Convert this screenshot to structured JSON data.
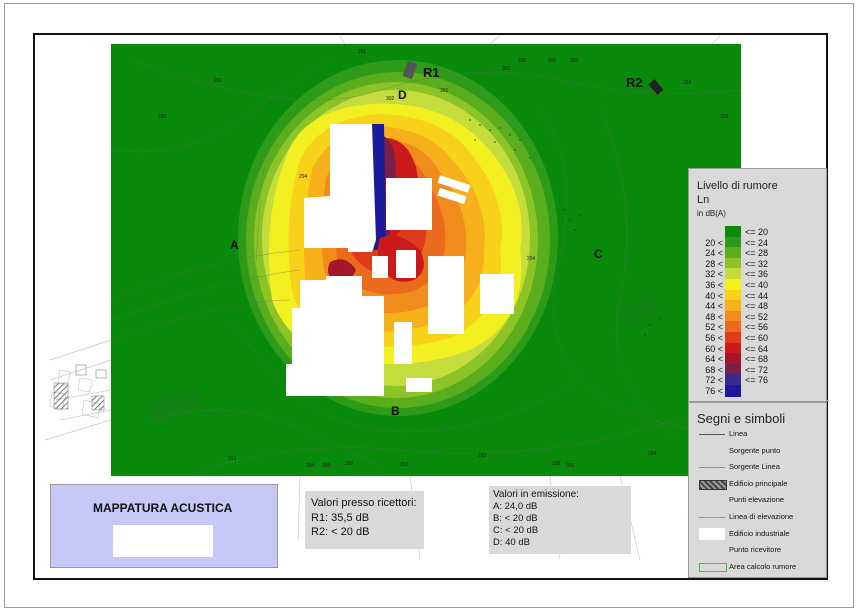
{
  "map": {
    "receptor_labels": [
      "R1",
      "R2"
    ],
    "point_labels": [
      "A",
      "B",
      "C",
      "D"
    ],
    "elevations": [
      "291",
      "290",
      "291",
      "293",
      "291",
      "292",
      "289",
      "298",
      "294",
      "294",
      "293",
      "294",
      "289",
      "290",
      "292",
      "293",
      "300",
      "306",
      "284",
      "302",
      "301",
      "307"
    ]
  },
  "legend": {
    "title": "Livello di rumore",
    "subtitle": "Ln",
    "unit": "in dB(A)",
    "classes": [
      {
        "lo": "",
        "hi": "<= 20",
        "color": "#0a8a0a"
      },
      {
        "lo": "20 <",
        "hi": "<= 24",
        "color": "#2e9a1a"
      },
      {
        "lo": "24 <",
        "hi": "<= 28",
        "color": "#5aae1e"
      },
      {
        "lo": "28 <",
        "hi": "<= 32",
        "color": "#8cc428"
      },
      {
        "lo": "32 <",
        "hi": "<= 36",
        "color": "#c4dc3c"
      },
      {
        "lo": "36 <",
        "hi": "<= 40",
        "color": "#f2f020"
      },
      {
        "lo": "40 <",
        "hi": "<= 44",
        "color": "#f8d21a"
      },
      {
        "lo": "44 <",
        "hi": "<= 48",
        "color": "#f6b01c"
      },
      {
        "lo": "48 <",
        "hi": "<= 52",
        "color": "#f08c1c"
      },
      {
        "lo": "52 <",
        "hi": "<= 56",
        "color": "#ea6a1e"
      },
      {
        "lo": "56 <",
        "hi": "<= 60",
        "color": "#e03a1c"
      },
      {
        "lo": "60 <",
        "hi": "<= 64",
        "color": "#cc1a1a"
      },
      {
        "lo": "64 <",
        "hi": "<= 68",
        "color": "#a41628"
      },
      {
        "lo": "68 <",
        "hi": "<= 72",
        "color": "#78204a"
      },
      {
        "lo": "72 <",
        "hi": "<= 76",
        "color": "#3a2a8a"
      },
      {
        "lo": "76 <",
        "hi": "",
        "color": "#1a1a9a"
      }
    ]
  },
  "symbols": {
    "title": "Segni e simboli",
    "items": [
      {
        "label": "Linea",
        "style": "line",
        "color": "#555555"
      },
      {
        "label": "Sorgente punto",
        "style": "none",
        "color": "#999999"
      },
      {
        "label": "Sorgente Linea",
        "style": "line",
        "color": "#b070c0"
      },
      {
        "label": "Edificio principale",
        "style": "hatch",
        "color": "#555555"
      },
      {
        "label": "Punti elevazione",
        "style": "none",
        "color": "#999999"
      },
      {
        "label": "Linea di elevazione",
        "style": "line",
        "color": "#d09050"
      },
      {
        "label": "Edificio industriale",
        "style": "box",
        "color": "#ffffff"
      },
      {
        "label": "Punto ricevitore",
        "style": "none",
        "color": "#999999"
      },
      {
        "label": "Area calcolo rumore",
        "style": "outline",
        "color": "#40c040"
      }
    ]
  },
  "title_block": {
    "title": "MAPPATURA ACUSTICA"
  },
  "receptors_box": {
    "heading": "Valori presso ricettori:",
    "lines": [
      "R1: 35,5 dB",
      "R2: < 20 dB"
    ]
  },
  "emission_box": {
    "heading": "Valori in emissione:",
    "lines": [
      "A: 24,0 dB",
      "B: < 20 dB",
      "C:  < 20 dB",
      "D:  40 dB"
    ]
  }
}
